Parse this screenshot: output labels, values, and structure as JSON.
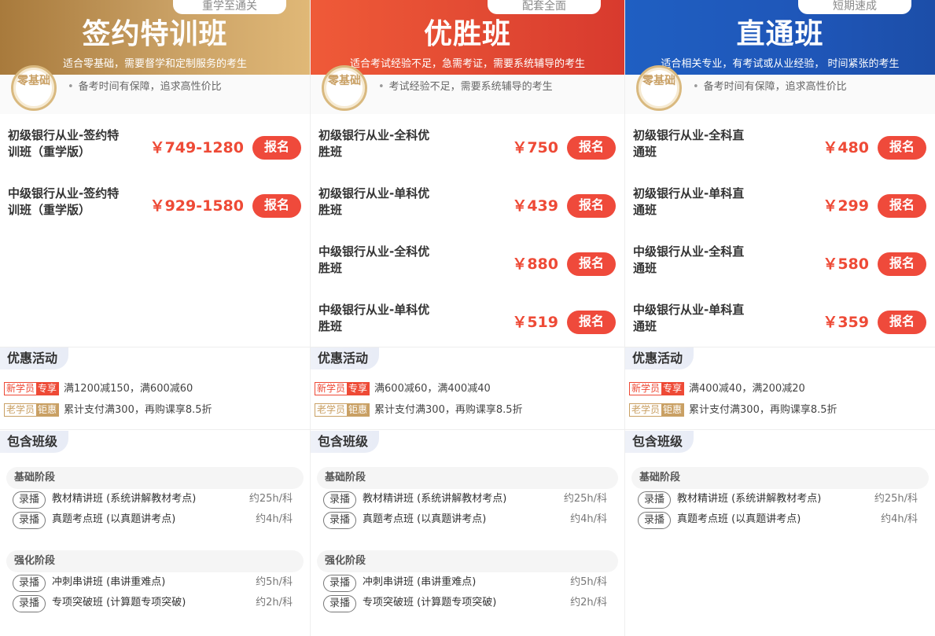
{
  "columns": [
    {
      "ribbon": "重学至通关",
      "title": "签约特训班",
      "subtitle": "适合零基础，需要督学和定制服务的考生",
      "badge": "零基础",
      "intro": "备考时间有保障，追求高性价比",
      "courses": [
        {
          "name": "初级银行从业-签约特训班（重学版）",
          "price": "￥749-1280",
          "button": "报名"
        },
        {
          "name": "中级银行从业-签约特训班（重学版）",
          "price": "￥929-1580",
          "button": "报名"
        }
      ],
      "promo_title": "优惠活动",
      "promo_new": {
        "tag1": "新学员",
        "tag2": "专享",
        "text": "满1200减150，满600减60"
      },
      "promo_old": {
        "tag1": "老学员",
        "tag2": "钜惠",
        "text": "累计支付满300，再购课享8.5折"
      },
      "included_title": "包含班级",
      "stages": [
        {
          "name": "基础阶段",
          "items": [
            {
              "tag": "录播",
              "name": "教材精讲班 (系统讲解教材考点)",
              "hours": "约25h/科"
            },
            {
              "tag": "录播",
              "name": "真题考点班 (以真题讲考点)",
              "hours": "约4h/科"
            }
          ]
        },
        {
          "name": "强化阶段",
          "items": [
            {
              "tag": "录播",
              "name": "冲刺串讲班 (串讲重难点)",
              "hours": "约5h/科"
            },
            {
              "tag": "录播",
              "name": "专项突破班 (计算题专项突破)",
              "hours": "约2h/科"
            }
          ]
        }
      ]
    },
    {
      "ribbon": "配套全面",
      "title": "优胜班",
      "subtitle": "适合考试经验不足，急需考证，需要系统辅导的考生",
      "badge": "零基础",
      "intro": "考试经验不足，需要系统辅导的考生",
      "courses": [
        {
          "name": "初级银行从业-全科优胜班",
          "price": "￥750",
          "button": "报名"
        },
        {
          "name": "初级银行从业-单科优胜班",
          "price": "￥439",
          "button": "报名"
        },
        {
          "name": "中级银行从业-全科优胜班",
          "price": "￥880",
          "button": "报名"
        },
        {
          "name": "中级银行从业-单科优胜班",
          "price": "￥519",
          "button": "报名"
        }
      ],
      "promo_title": "优惠活动",
      "promo_new": {
        "tag1": "新学员",
        "tag2": "专享",
        "text": "满600减60，满400减40"
      },
      "promo_old": {
        "tag1": "老学员",
        "tag2": "钜惠",
        "text": "累计支付满300，再购课享8.5折"
      },
      "included_title": "包含班级",
      "stages": [
        {
          "name": "基础阶段",
          "items": [
            {
              "tag": "录播",
              "name": "教材精讲班 (系统讲解教材考点)",
              "hours": "约25h/科"
            },
            {
              "tag": "录播",
              "name": "真题考点班 (以真题讲考点)",
              "hours": "约4h/科"
            }
          ]
        },
        {
          "name": "强化阶段",
          "items": [
            {
              "tag": "录播",
              "name": "冲刺串讲班 (串讲重难点)",
              "hours": "约5h/科"
            },
            {
              "tag": "录播",
              "name": "专项突破班 (计算题专项突破)",
              "hours": "约2h/科"
            }
          ]
        }
      ]
    },
    {
      "ribbon": "短期速成",
      "title": "直通班",
      "subtitle": "适合相关专业，有考试或从业经验， 时间紧张的考生",
      "badge": "零基础",
      "intro": "备考时间有保障，追求高性价比",
      "courses": [
        {
          "name": "初级银行从业-全科直通班",
          "price": "￥480",
          "button": "报名"
        },
        {
          "name": "初级银行从业-单科直通班",
          "price": "￥299",
          "button": "报名"
        },
        {
          "name": "中级银行从业-全科直通班",
          "price": "￥580",
          "button": "报名"
        },
        {
          "name": "中级银行从业-单科直通班",
          "price": "￥359",
          "button": "报名"
        }
      ],
      "promo_title": "优惠活动",
      "promo_new": {
        "tag1": "新学员",
        "tag2": "专享",
        "text": "满400减40，满200减20"
      },
      "promo_old": {
        "tag1": "老学员",
        "tag2": "钜惠",
        "text": "累计支付满300，再购课享8.5折"
      },
      "included_title": "包含班级",
      "stages": [
        {
          "name": "基础阶段",
          "items": [
            {
              "tag": "录播",
              "name": "教材精讲班 (系统讲解教材考点)",
              "hours": "约25h/科"
            },
            {
              "tag": "录播",
              "name": "真题考点班 (以真题讲考点)",
              "hours": "约4h/科"
            }
          ]
        }
      ]
    }
  ],
  "colors": {
    "accent_red": "#ee4a36",
    "gold": "#c9a064",
    "blue": "#1f56b8"
  }
}
